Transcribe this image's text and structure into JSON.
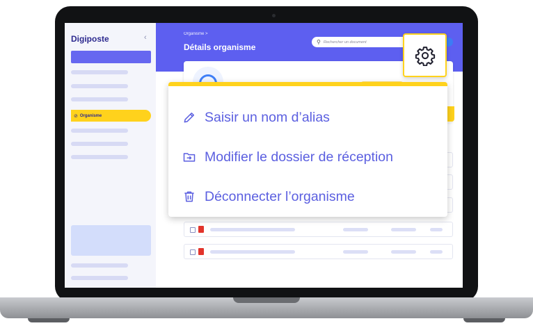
{
  "sidebar": {
    "brand": "Digiposte",
    "collapse_icon": "chevron-left-icon",
    "active_item": {
      "icon": "check-circle-icon",
      "label": "Organisme"
    }
  },
  "header": {
    "breadcrumb": "Organisme >",
    "title": "Détails organisme",
    "search": {
      "icon": "search-icon",
      "placeholder": "Rechercher un document"
    }
  },
  "settings": {
    "icon": "gear-icon"
  },
  "menu": {
    "items": [
      {
        "icon": "pencil-icon",
        "label": "Saisir un nom d’alias"
      },
      {
        "icon": "folder-move-icon",
        "label": "Modifier le dossier de réception"
      },
      {
        "icon": "trash-icon",
        "label": "Déconnecter l’organisme"
      }
    ]
  },
  "colors": {
    "accent": "#5d5ff0",
    "highlight": "#ffd21c",
    "menu_text": "#5b5fe0"
  }
}
